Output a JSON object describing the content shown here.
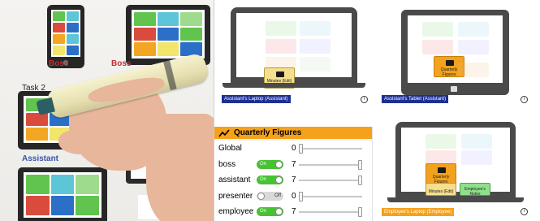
{
  "photo": {
    "labels": {
      "boss_phone": "Boss",
      "boss_tablet": "Boss",
      "task": "Task 2",
      "assistant": "Assistant",
      "cut_text": "ente"
    }
  },
  "devices": {
    "assistant_laptop": {
      "label": "Assistant's Laptop (Assistant)",
      "card": "Minutes (Edit)"
    },
    "assistant_tablet": {
      "label": "Assistant's Tablet (Assistant)",
      "card": "Quarterly Figures"
    },
    "employee_laptop": {
      "label": "Employee's Laptop (Employee)",
      "cards": [
        "Quarterly Figures",
        "Minutes (Edit)",
        "Employee's Notes"
      ]
    }
  },
  "quarterly_figures": {
    "title": "Quarterly Figures",
    "rows": [
      {
        "name": "Global",
        "value": "0",
        "toggle": null,
        "level": 0
      },
      {
        "name": "boss",
        "value": "7",
        "toggle": "On",
        "level": 1.0
      },
      {
        "name": "assistant",
        "value": "7",
        "toggle": "On",
        "level": 1.0
      },
      {
        "name": "presenter",
        "value": "0",
        "toggle": "Off",
        "level": 0
      },
      {
        "name": "employee",
        "value": "7",
        "toggle": "On",
        "level": 1.0
      }
    ]
  },
  "colors": {
    "accent": "#f5a11b",
    "device_label": "#1c2f93",
    "toggle_on": "#47c233"
  },
  "icons": [
    "info-icon",
    "chart-line-icon",
    "minutes-icon",
    "notes-icon"
  ]
}
